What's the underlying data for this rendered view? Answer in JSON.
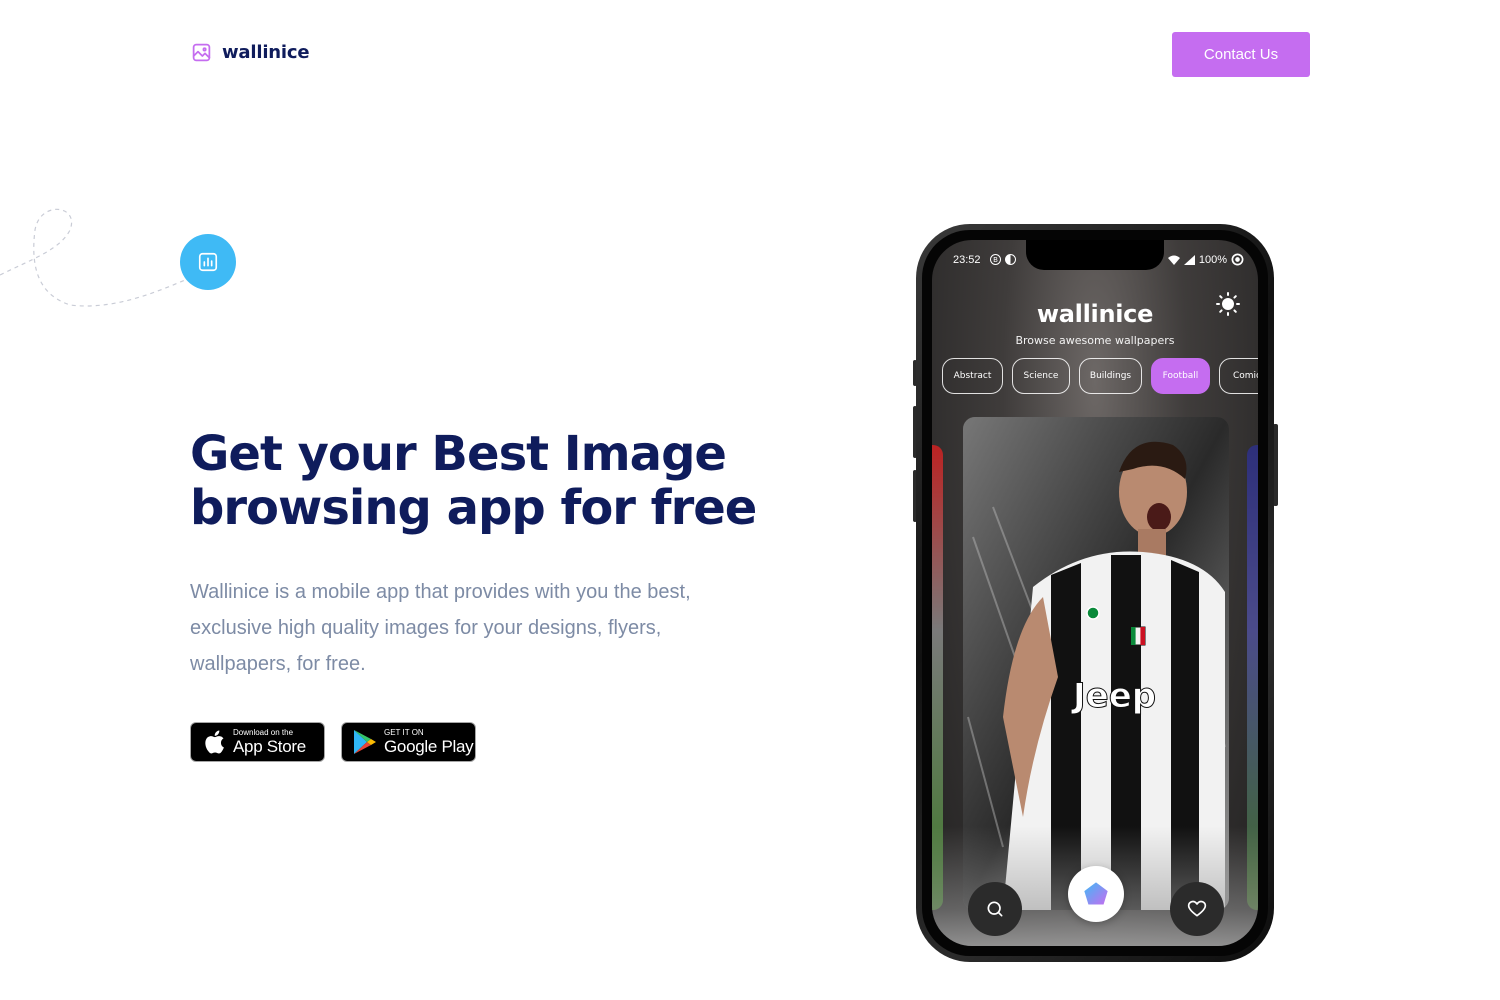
{
  "header": {
    "brand": "wallinice",
    "contact_label": "Contact Us"
  },
  "hero": {
    "title_line1": "Get your Best Image",
    "title_line2": "browsing app for free",
    "description": "Wallinice is a mobile app that provides with you the best, exclusive high quality images for your designs, flyers, wallpapers, for free."
  },
  "badges": {
    "apple_small": "Download on the",
    "apple_big": "App Store",
    "google_small": "GET IT ON",
    "google_big": "Google Play"
  },
  "phone": {
    "status_time": "23:52",
    "status_battery": "100%",
    "app_title": "wallinice",
    "app_subtitle": "Browse awesome wallpapers",
    "categories": [
      "Abstract",
      "Science",
      "Buildings",
      "Football",
      "Comic"
    ],
    "active_category": "Football",
    "card_text_jeep": "Jeep"
  },
  "colors": {
    "brand_navy": "#0f1c5c",
    "accent_purple": "#c56df0",
    "bubble_blue": "#3fbaf5",
    "body_text": "#7d8ba5"
  },
  "icons": {
    "logo": "image-icon",
    "bubble": "bar-chart-icon",
    "theme": "sun-icon",
    "nav_left": "search-icon",
    "nav_center": "home-pentagon-icon",
    "nav_right": "heart-icon"
  }
}
